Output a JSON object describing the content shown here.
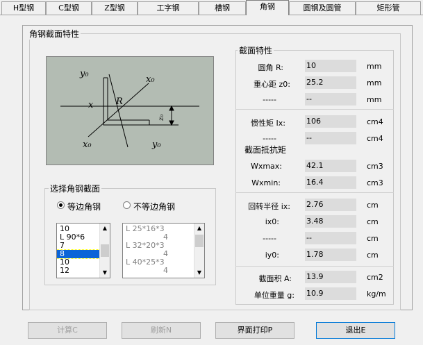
{
  "tabs": [
    "H型钢",
    "C型钢",
    "Z型钢",
    "工字钢",
    "槽钢",
    "角钢",
    "圆钢及圆管",
    "矩形管"
  ],
  "group_section": "角钢截面特性",
  "diagram": {
    "labels": {
      "y0_top": "y₀",
      "x0_top": "x₀",
      "x_left": "x",
      "R": "R",
      "x0_bottom": "x₀",
      "y0_bottom": "y₀",
      "z0": "z₀"
    }
  },
  "properties": {
    "title": "截面特性",
    "rows": [
      {
        "label": "圆角   R:",
        "value": "10",
        "unit": "mm"
      },
      {
        "label": "重心距 z0:",
        "value": "25.2",
        "unit": "mm"
      },
      {
        "label": "-----",
        "value": "--",
        "unit": "mm"
      },
      {
        "label": "惯性矩 Ix:",
        "value": "106",
        "unit": "cm4"
      },
      {
        "label": "-----",
        "value": "--",
        "unit": "cm4"
      }
    ],
    "resist_title": "截面抵抗矩",
    "resist_rows": [
      {
        "label": "Wxmax:",
        "value": "42.1",
        "unit": "cm3"
      },
      {
        "label": "Wxmin:",
        "value": "16.4",
        "unit": "cm3"
      }
    ],
    "radius_rows": [
      {
        "label": "回转半径 ix:",
        "value": "2.76",
        "unit": "cm"
      },
      {
        "label": "ix0:",
        "value": "3.48",
        "unit": "cm"
      },
      {
        "label": "-----",
        "value": "--",
        "unit": "cm"
      },
      {
        "label": "iy0:",
        "value": "1.78",
        "unit": "cm"
      }
    ],
    "area_rows": [
      {
        "label": "截面积 A:",
        "value": "13.9",
        "unit": "cm2"
      },
      {
        "label": "单位重量 g:",
        "value": "10.9",
        "unit": "kg/m"
      }
    ]
  },
  "select": {
    "title": "选择角钢截面",
    "radio_equal": "等边角钢",
    "radio_unequal": "不等边角钢",
    "equal_list": [
      "10",
      "L 90*6",
      "7",
      "8",
      "10",
      "12"
    ],
    "unequal_list": [
      "L 25*16*3",
      "4",
      "L 32*20*3",
      "4",
      "L 40*25*3",
      "4"
    ]
  },
  "buttons": {
    "calc": "计算C",
    "refresh": "刷新N",
    "print": "界面打印P",
    "exit": "退出E"
  }
}
